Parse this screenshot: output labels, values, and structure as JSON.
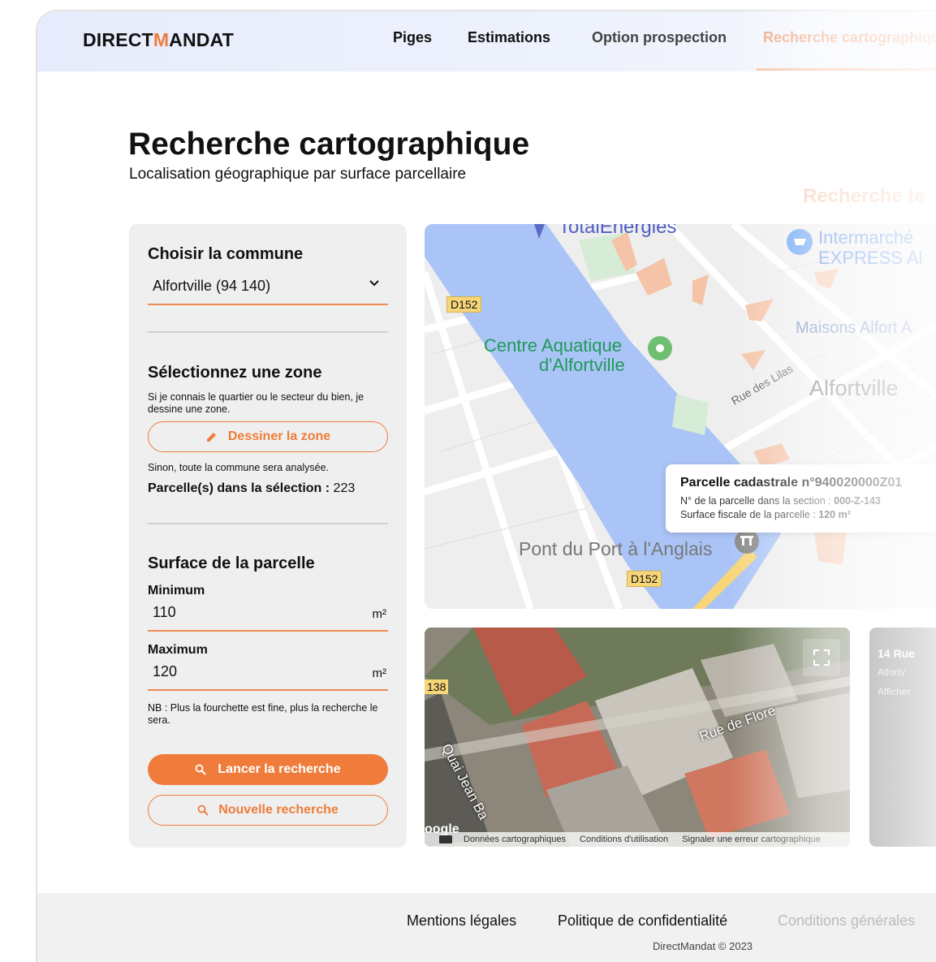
{
  "header": {
    "logo_part1": "DIRECT",
    "logo_part2": "M",
    "logo_part3": "ANDAT",
    "nav": [
      "Piges",
      "Estimations",
      "Option prospection",
      "Recherche cartographique"
    ]
  },
  "page": {
    "title": "Recherche cartographique",
    "subtitle": "Localisation géographique par surface parcellaire",
    "ghost_title": "Recherche te"
  },
  "commune": {
    "heading": "Choisir la commune",
    "selected": "Alfortville (94 140)"
  },
  "zone": {
    "heading": "Sélectionnez une zone",
    "help": "Si je connais le quartier ou le secteur du bien, je dessine une zone.",
    "draw_button": "Dessiner la zone",
    "fallback": "Sinon, toute la commune sera analysée.",
    "count_label": "Parcelle(s) dans la sélection :",
    "count_value": "223"
  },
  "surface": {
    "heading": "Surface de la parcelle",
    "min_label": "Minimum",
    "min_value": "110",
    "max_label": "Maximum",
    "max_value": "120",
    "unit": "m²",
    "note": "NB : Plus la fourchette est fine, plus la recherche le sera."
  },
  "actions": {
    "search": "Lancer la recherche",
    "new_search": "Nouvelle recherche"
  },
  "map": {
    "labels": {
      "total": "TotalEnergies",
      "intermarche": "Intermarché",
      "express": "EXPRESS Al",
      "d152_a": "D152",
      "d152_b": "D152",
      "centre1": "Centre Aquatique",
      "centre2": "d'Alfortville",
      "maisons": "Maisons Alfort A",
      "lilas": "Rue des Lilas",
      "alfortville": "Alfortville",
      "pont": "Pont du Port à l'Anglais"
    },
    "tooltip": {
      "title": "Parcelle cadastrale n°940020000Z01",
      "line1_label": "N° de la parcelle dans la section :",
      "line1_value": "000-Z-143",
      "line2_label": "Surface fiscale de la parcelle :",
      "line2_value": "120 m²"
    },
    "colors": {
      "water": "#aac4f7",
      "parcel": "#f5c3a8",
      "land": "#f1f1f1",
      "road": "#ffffff",
      "park": "#d6ecd6"
    }
  },
  "satellite": {
    "road_number": "138",
    "street1": "Quai Jean Ba",
    "street2": "Rue de Flore",
    "google": "oogle",
    "attribution": [
      "Données cartographiques",
      "Conditions d'utilisation",
      "Signaler une erreur cartographique"
    ]
  },
  "side_card": {
    "title": "14 Rue",
    "line1": "Alfortv",
    "line2": "Afficher"
  },
  "footer": {
    "links": [
      "Mentions légales",
      "Politique de confidentialité",
      "Conditions générales"
    ],
    "copyright": "DirectMandat © 2023"
  }
}
